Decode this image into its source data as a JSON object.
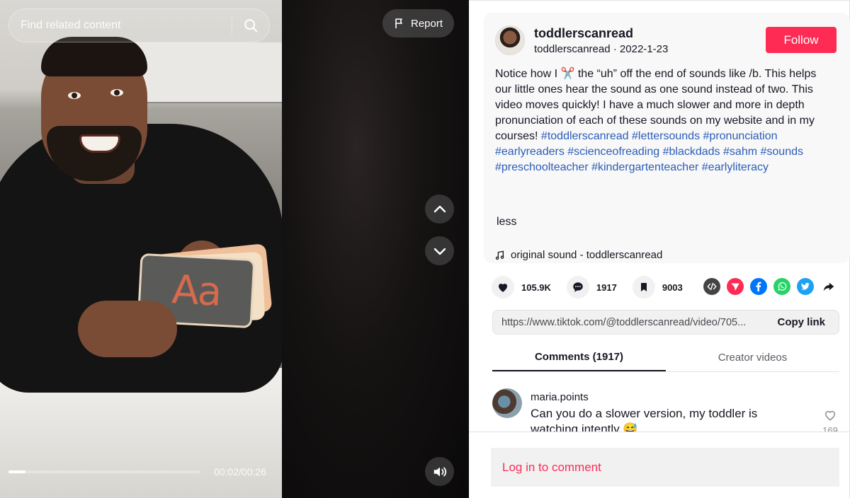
{
  "video": {
    "search_placeholder": "Find related content",
    "report_label": "Report",
    "card_text": "Aa",
    "time": "00:02/00:26",
    "progress": 0.09
  },
  "author": {
    "username": "toddlerscanread",
    "handle": "toddlerscanread",
    "separator": " · ",
    "date": "2022-1-23",
    "follow_label": "Follow"
  },
  "description": {
    "text_before": "Notice how I ",
    "emoji": "✂️",
    "text_after": " the “uh” off the end of sounds like /b. This helps our little ones hear the sound as one sound instead of two. This video moves quickly! I have a much slower and more in depth pronunciation of each of these sounds on my website and in my courses! ",
    "hashtags": [
      "#toddlerscanread",
      "#lettersounds",
      "#pronunciation",
      "#earlyreaders",
      "#scienceofreading",
      "#blackdads",
      "#sahm",
      "#sounds",
      "#preschoolteacher",
      "#kindergartenteacher",
      "#earlyliteracy"
    ],
    "less_label": "less",
    "sound": "original sound - toddlerscanread"
  },
  "stats": {
    "likes": "105.9K",
    "comments": "1917",
    "saves": "9003"
  },
  "share": {
    "icons": [
      "embed-icon",
      "send-icon",
      "facebook-icon",
      "whatsapp-icon",
      "twitter-icon",
      "share-arrow-icon"
    ],
    "colors": {
      "embed": "#444444",
      "send": "#fe2c55",
      "facebook": "#0075fa",
      "whatsapp": "#25d366",
      "twitter": "#1da1f2"
    }
  },
  "link": {
    "url": "https://www.tiktok.com/@toddlerscanread/video/705...",
    "copy_label": "Copy link"
  },
  "tabs": [
    {
      "label": "Comments (1917)"
    },
    {
      "label": "Creator videos"
    }
  ],
  "comments": [
    {
      "user": "maria.points",
      "text": "Can you do a slower version, my toddler is watching intently 😅",
      "likes": "169"
    }
  ],
  "login": {
    "label": "Log in to comment"
  },
  "colors": {
    "accent": "#fe2c55",
    "hashtag": "#2b5db9"
  }
}
